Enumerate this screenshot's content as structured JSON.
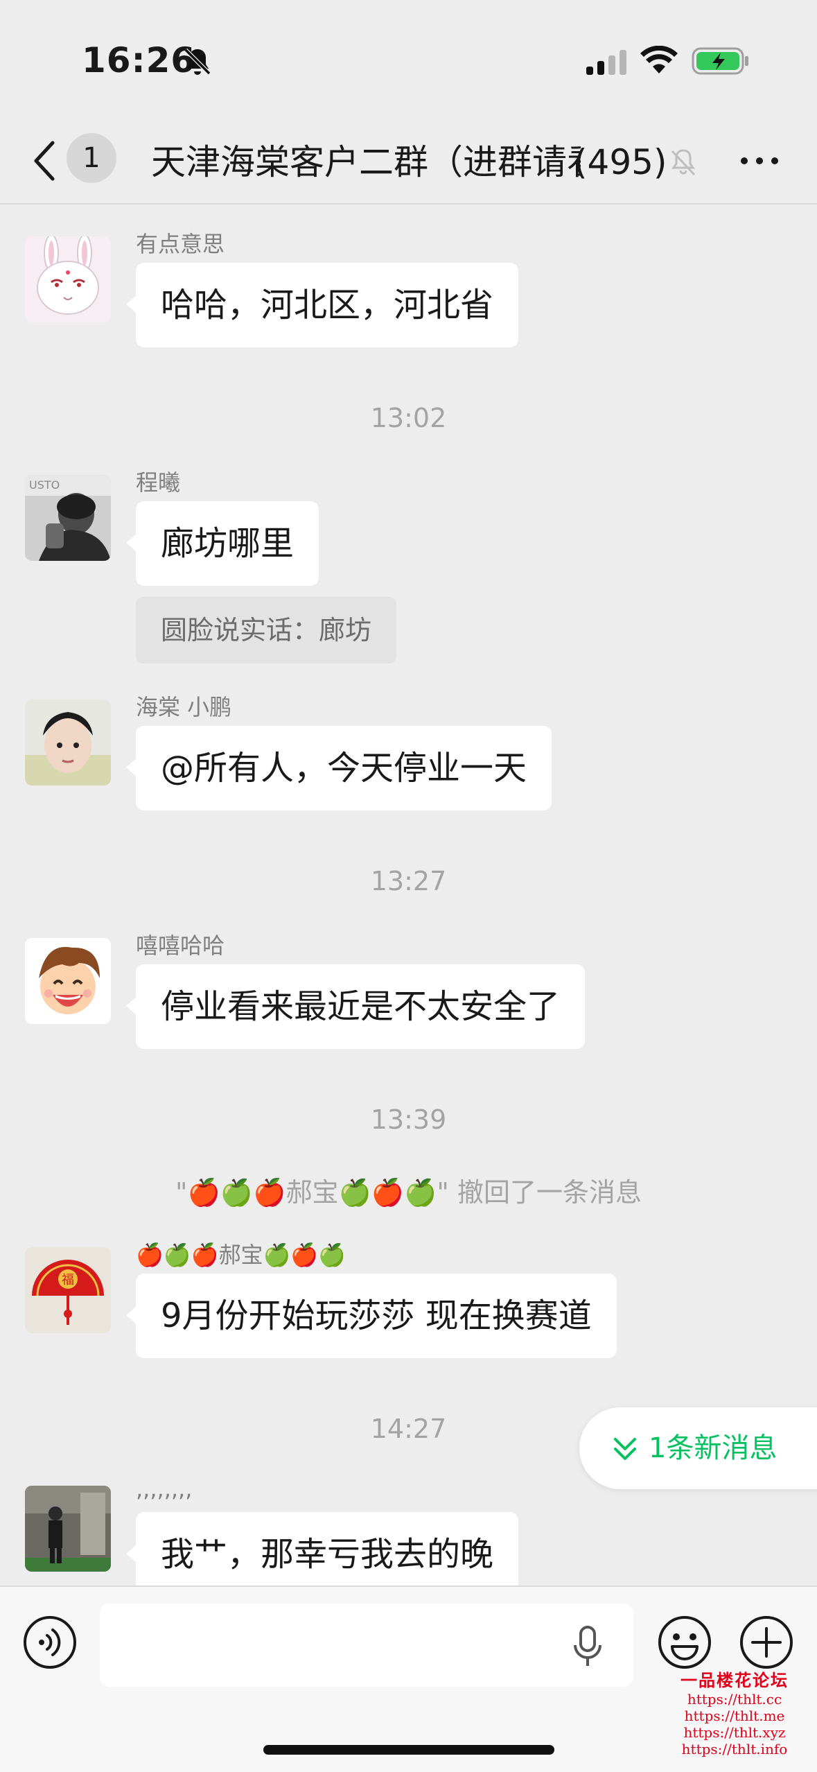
{
  "status_bar": {
    "time": "16:26"
  },
  "nav": {
    "unread_count": "1",
    "title": "天津海棠客户二群（进群请看",
    "member_count": "(495)"
  },
  "messages": [
    {
      "sender": "有点意思",
      "text": "哈哈，河北区，河北省"
    },
    {
      "timestamp": "13:02"
    },
    {
      "sender": "程曦",
      "text": "廊坊哪里",
      "quote": "圆脸说实话：廊坊"
    },
    {
      "sender": "海棠 小鹏",
      "text": "@所有人，今天停业一天"
    },
    {
      "timestamp": "13:27"
    },
    {
      "sender": "嘻嘻哈哈",
      "text": "停业看来最近是不太安全了"
    },
    {
      "timestamp": "13:39"
    },
    {
      "system": "\"🍎🍏🍎郝宝🍏🍎🍏\" 撤回了一条消息"
    },
    {
      "sender": "🍎🍏🍎郝宝🍏🍎🍏",
      "text": "9月份开始玩莎莎 现在换赛道"
    },
    {
      "timestamp": "14:27"
    },
    {
      "sender": ",,,,,,,,",
      "text": "我艹，那幸亏我去的晚"
    }
  ],
  "new_messages": {
    "label": "1条新消息"
  },
  "input": {
    "placeholder": ""
  },
  "watermark": {
    "title": "一品楼花论坛",
    "lines": [
      "https://thlt.cc",
      "https://thlt.me",
      "https://thlt.xyz",
      "https://thlt.info"
    ]
  },
  "colors": {
    "background": "#ededed",
    "bubble": "#ffffff",
    "accent": "#07c160"
  },
  "icons": [
    "bell-off-icon",
    "signal-icon",
    "wifi-icon",
    "battery-charging-icon",
    "back-chevron-icon",
    "mute-icon",
    "more-icon",
    "double-chevron-down-icon",
    "voice-icon",
    "microphone-icon",
    "emoji-icon",
    "plus-icon"
  ]
}
